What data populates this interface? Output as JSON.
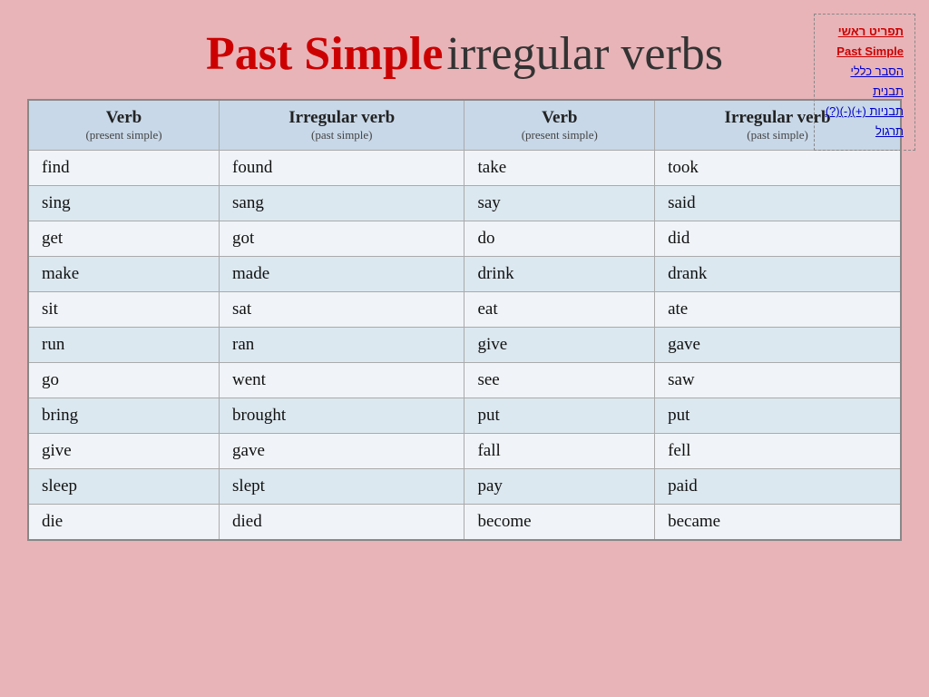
{
  "title": {
    "part1": "Past Simple",
    "part2": "irregular verbs"
  },
  "nav": {
    "items": [
      {
        "label": "תפריט ראשי",
        "active": true
      },
      {
        "label": "Past Simple",
        "active": true
      },
      {
        "label": "הסבר כללי",
        "active": false
      },
      {
        "label": "תבנית",
        "active": false
      },
      {
        "label": "תבניות (+)(-)(?)‏",
        "active": false
      },
      {
        "label": "תרגול",
        "active": false
      }
    ]
  },
  "table": {
    "headers": [
      {
        "main": "Verb",
        "sub": "(present simple)"
      },
      {
        "main": "Irregular verb",
        "sub": "(past simple)"
      },
      {
        "main": "Verb",
        "sub": "(present simple)"
      },
      {
        "main": "Irregular verb",
        "sub": "(past simple)"
      }
    ],
    "rows": [
      [
        "find",
        "found",
        "take",
        "took"
      ],
      [
        "sing",
        "sang",
        "say",
        "said"
      ],
      [
        "get",
        "got",
        "do",
        "did"
      ],
      [
        "make",
        "made",
        "drink",
        "drank"
      ],
      [
        "sit",
        "sat",
        "eat",
        "ate"
      ],
      [
        "run",
        "ran",
        "give",
        "gave"
      ],
      [
        "go",
        "went",
        "see",
        "saw"
      ],
      [
        "bring",
        "brought",
        "put",
        "put"
      ],
      [
        "give",
        "gave",
        "fall",
        "fell"
      ],
      [
        "sleep",
        "slept",
        "pay",
        "paid"
      ],
      [
        "die",
        "died",
        "become",
        "became"
      ]
    ]
  }
}
